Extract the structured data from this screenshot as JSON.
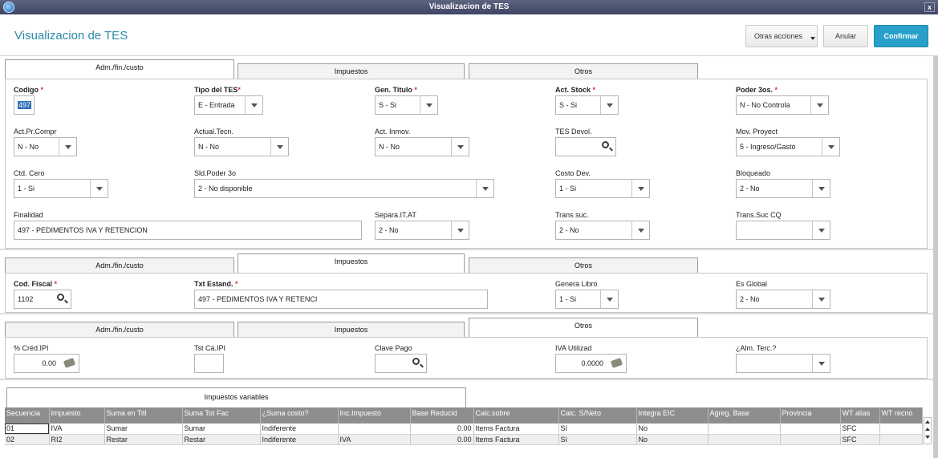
{
  "window": {
    "title": "Visualizacion de TES",
    "close": "x"
  },
  "header": {
    "title": "Visualizacion de TES",
    "other_actions": "Otras acciones",
    "cancel": "Anular",
    "confirm": "Confirmar"
  },
  "tabs": {
    "t1": "Adm./fin./custo",
    "t2": "Impuestos",
    "t3": "Otros"
  },
  "adm": {
    "codigo": {
      "label": "Codigo",
      "value": "497"
    },
    "tipo_tes": {
      "label": "Tipo del TES",
      "value": "E - Entrada"
    },
    "gen_titulo": {
      "label": "Gen. Titulo",
      "value": "S - Si"
    },
    "act_stock": {
      "label": "Act. Stock",
      "value": "S - Si"
    },
    "poder_3os": {
      "label": "Poder 3os.",
      "value": "N - No Controla"
    },
    "act_pr_compr": {
      "label": "Act.Pr.Compr",
      "value": "N - No"
    },
    "actual_tecn": {
      "label": "Actual.Tecn.",
      "value": "N - No"
    },
    "act_inmov": {
      "label": "Act. Inmov.",
      "value": "N - No"
    },
    "tes_devol": {
      "label": "TES Devol.",
      "value": ""
    },
    "mov_proyect": {
      "label": "Mov. Proyect",
      "value": "5 - Ingreso/Gasto"
    },
    "ctd_cero": {
      "label": "Ctd. Cero",
      "value": "1 - Si"
    },
    "sld_poder": {
      "label": "Sld.Poder 3o",
      "value": "2 - No disponible"
    },
    "costo_dev": {
      "label": "Costo Dev.",
      "value": "1 - Si"
    },
    "bloqueado": {
      "label": "Bloqueado",
      "value": "2 - No"
    },
    "finalidad": {
      "label": "Finalidad",
      "value": "497 - PEDIMENTOS IVA Y RETENCION"
    },
    "separa": {
      "label": "Separa.IT.AT",
      "value": "2 - No"
    },
    "trans_suc": {
      "label": "Trans suc.",
      "value": "2 - No"
    },
    "trans_suc_cq": {
      "label": "Trans.Suc CQ",
      "value": ""
    }
  },
  "imp": {
    "cod_fiscal": {
      "label": "Cod. Fiscal",
      "value": "1102"
    },
    "txt_estand": {
      "label": "Txt Estand.",
      "value": "497 - PEDIMENTOS IVA Y RETENCI"
    },
    "genera_libro": {
      "label": "Genera Libro",
      "value": "1 - Si"
    },
    "es_global": {
      "label": "Es Global",
      "value": "2 - No"
    }
  },
  "otros": {
    "cred_ipi": {
      "label": "% Créd.IPI",
      "value": "0.00"
    },
    "tst_ca_ipi": {
      "label": "Tst Cá.IPI",
      "value": ""
    },
    "clave_pago": {
      "label": "Clave Pago",
      "value": ""
    },
    "iva_utilizad": {
      "label": "IVA Utilizad",
      "value": "0.0000"
    },
    "alm_terc": {
      "label": "¿Alm. Terc.?",
      "value": ""
    }
  },
  "impuestos_variables": {
    "tab_label": "Impuestos variables",
    "columns": [
      "Secuencia",
      "Impuesto",
      "Suma en Titl",
      "Suma Tot Fac",
      "¿Suma costo?",
      "Inc.Impuesto",
      "Base Reducid",
      "Calc.sobre",
      "Calc. S/Neto",
      "Integra EIC",
      "Agreg. Base",
      "Provincia",
      "WT alias",
      "WT recno"
    ],
    "rows": [
      [
        "01",
        "IVA",
        "Sumar",
        "Sumar",
        "Indiferente",
        "",
        "0.00",
        "Items Factura",
        "Sí",
        "No",
        "",
        "",
        "SFC",
        ""
      ],
      [
        "02",
        "RI2",
        "Restar",
        "Restar",
        "Indiferente",
        "IVA",
        "0.00",
        "Items Factura",
        "Sí",
        "No",
        "",
        "",
        "SFC",
        ""
      ]
    ]
  }
}
